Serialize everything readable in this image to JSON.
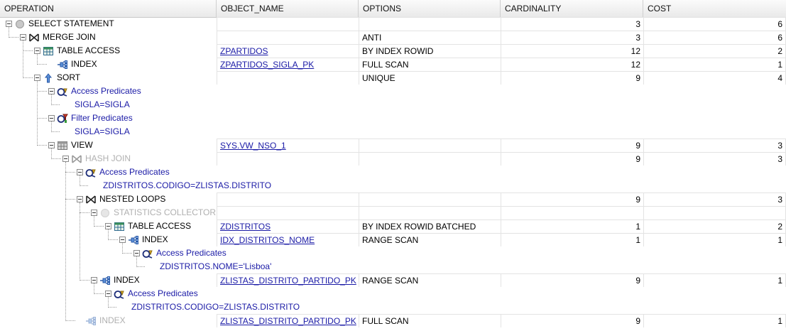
{
  "columns": [
    "OPERATION",
    "OBJECT_NAME",
    "OPTIONS",
    "CARDINALITY",
    "COST"
  ],
  "rows": [
    {
      "op": "SELECT STATEMENT",
      "obj": "",
      "opt": "",
      "card": "3",
      "cost": "6"
    },
    {
      "op": "MERGE JOIN",
      "obj": "",
      "opt": "ANTI",
      "card": "3",
      "cost": "6"
    },
    {
      "op": "TABLE ACCESS",
      "obj": "ZPARTIDOS",
      "opt": "BY INDEX ROWID",
      "card": "12",
      "cost": "2"
    },
    {
      "op": "INDEX",
      "obj": "ZPARTIDOS_SIGLA_PK",
      "opt": "FULL SCAN",
      "card": "12",
      "cost": "1"
    },
    {
      "op": "SORT",
      "obj": "",
      "opt": "UNIQUE",
      "card": "9",
      "cost": "4"
    },
    {
      "op": "Access Predicates",
      "obj": "",
      "opt": "",
      "card": "",
      "cost": ""
    },
    {
      "op": "SIGLA=SIGLA",
      "obj": "",
      "opt": "",
      "card": "",
      "cost": ""
    },
    {
      "op": "Filter Predicates",
      "obj": "",
      "opt": "",
      "card": "",
      "cost": ""
    },
    {
      "op": "SIGLA=SIGLA",
      "obj": "",
      "opt": "",
      "card": "",
      "cost": ""
    },
    {
      "op": "VIEW",
      "obj": "SYS.VW_NSO_1",
      "opt": "",
      "card": "9",
      "cost": "3"
    },
    {
      "op": "HASH JOIN",
      "obj": "",
      "opt": "",
      "card": "9",
      "cost": "3"
    },
    {
      "op": "Access Predicates",
      "obj": "",
      "opt": "",
      "card": "",
      "cost": ""
    },
    {
      "op": "ZDISTRITOS.CODIGO=ZLISTAS.DISTRITO",
      "obj": "",
      "opt": "",
      "card": "",
      "cost": ""
    },
    {
      "op": "NESTED LOOPS",
      "obj": "",
      "opt": "",
      "card": "9",
      "cost": "3"
    },
    {
      "op": "STATISTICS COLLECTOR",
      "obj": "",
      "opt": "",
      "card": "",
      "cost": ""
    },
    {
      "op": "TABLE ACCESS",
      "obj": "ZDISTRITOS",
      "opt": "BY INDEX ROWID BATCHED",
      "card": "1",
      "cost": "2"
    },
    {
      "op": "INDEX",
      "obj": "IDX_DISTRITOS_NOME",
      "opt": "RANGE SCAN",
      "card": "1",
      "cost": "1"
    },
    {
      "op": "Access Predicates",
      "obj": "",
      "opt": "",
      "card": "",
      "cost": ""
    },
    {
      "op": "ZDISTRITOS.NOME='Lisboa'",
      "obj": "",
      "opt": "",
      "card": "",
      "cost": ""
    },
    {
      "op": "INDEX",
      "obj": "ZLISTAS_DISTRITO_PARTIDO_PK",
      "opt": "RANGE SCAN",
      "card": "9",
      "cost": "1"
    },
    {
      "op": "Access Predicates",
      "obj": "",
      "opt": "",
      "card": "",
      "cost": ""
    },
    {
      "op": "ZDISTRITOS.CODIGO=ZLISTAS.DISTRITO",
      "obj": "",
      "opt": "",
      "card": "",
      "cost": ""
    },
    {
      "op": "INDEX",
      "obj": "ZLISTAS_DISTRITO_PARTIDO_PK",
      "opt": "FULL SCAN",
      "card": "9",
      "cost": "1"
    }
  ]
}
